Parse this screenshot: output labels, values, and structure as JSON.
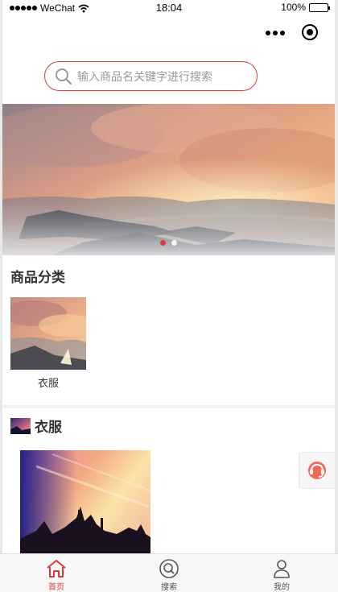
{
  "status_bar": {
    "carrier": "WeChat",
    "time": "18:04",
    "battery": "100%"
  },
  "search": {
    "placeholder": "输入商品名关键字进行搜索"
  },
  "banner": {
    "slide_count": 2,
    "active_index": 0
  },
  "category_section": {
    "title": "商品分类",
    "items": [
      {
        "label": "衣服"
      }
    ]
  },
  "clothing_section": {
    "title": "衣服"
  },
  "tab_bar": {
    "items": [
      {
        "label": "首页",
        "icon": "home-icon",
        "active": true
      },
      {
        "label": "搜索",
        "icon": "search-icon",
        "active": false
      },
      {
        "label": "我的",
        "icon": "user-icon",
        "active": false
      }
    ]
  },
  "colors": {
    "accent": "#e4393c",
    "tab_inactive": "#555555",
    "tab_bar_bg": "#f7f7f7"
  }
}
